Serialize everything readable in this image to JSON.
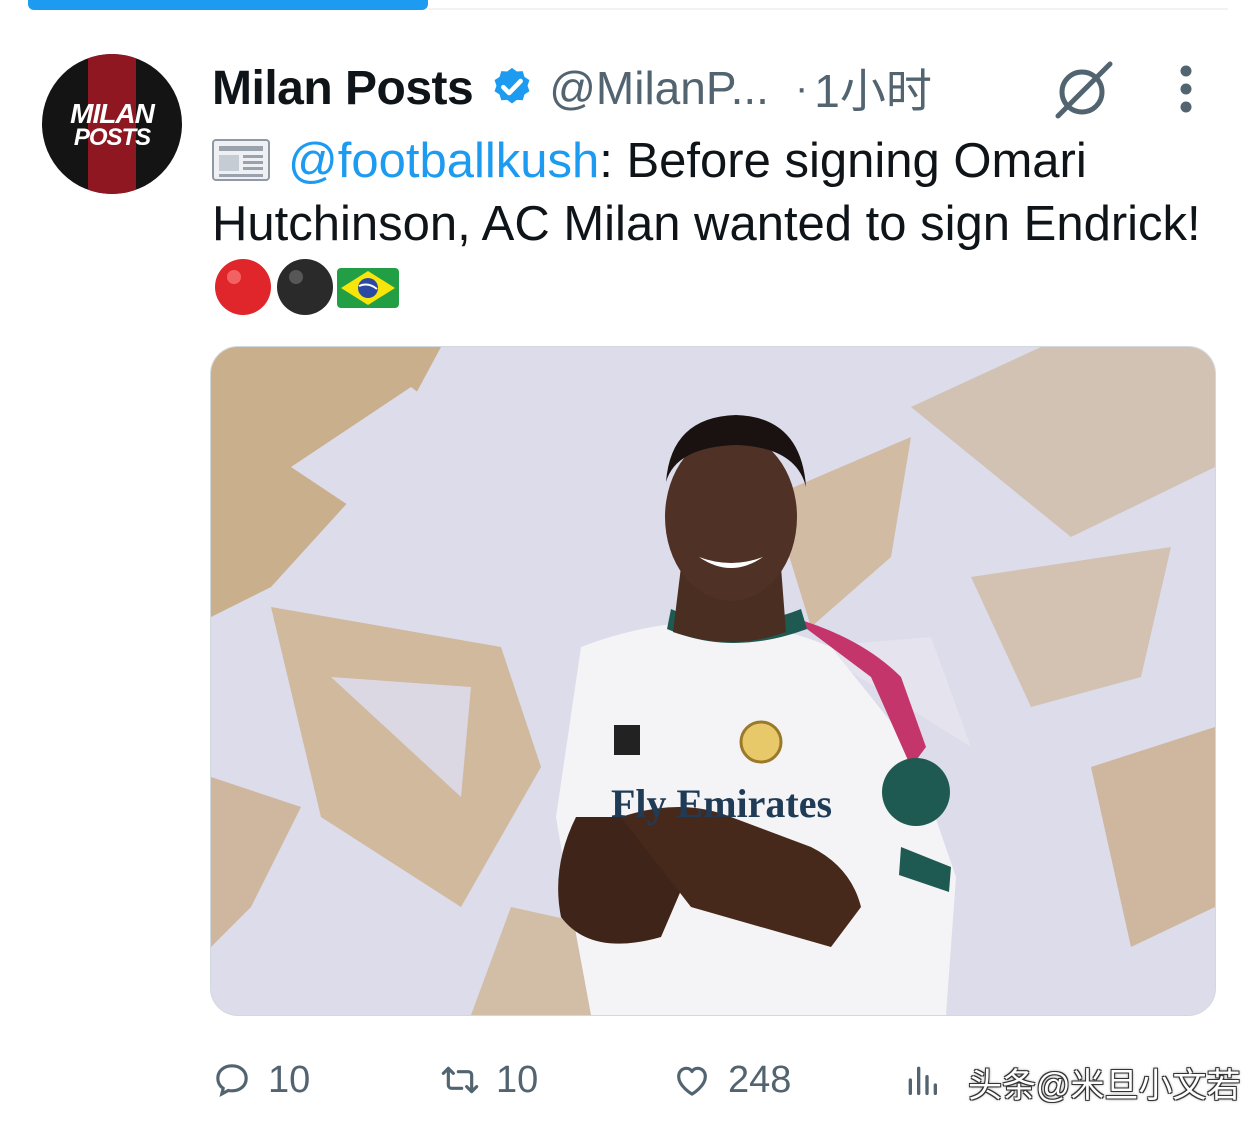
{
  "tweet": {
    "author": {
      "display_name": "Milan Posts",
      "handle": "@MilanP...",
      "avatar_text_line1": "MILAN",
      "avatar_text_line2": "POSTS"
    },
    "separator": "·",
    "time": "1小时",
    "text": {
      "mention": "@footballkush",
      "body": ": Before signing Omari Hutchinson, AC Milan wanted to sign Endrick! "
    },
    "media_alt": "Photo of a smiling player in a white jersey",
    "jersey_text": "Fly Emirates",
    "actions": {
      "replies": "10",
      "reposts": "10",
      "likes": "248"
    }
  },
  "watermark": "头条@米旦小文若",
  "colors": {
    "accent": "#1d9bf0",
    "muted": "#536471",
    "milan_red": "#8e1722"
  },
  "icons": [
    "verified-badge-icon",
    "grok-icon",
    "more-icon",
    "newspaper-icon",
    "red-circle-icon",
    "black-circle-icon",
    "brazil-flag-icon",
    "reply-icon",
    "repost-icon",
    "like-icon",
    "views-icon"
  ]
}
